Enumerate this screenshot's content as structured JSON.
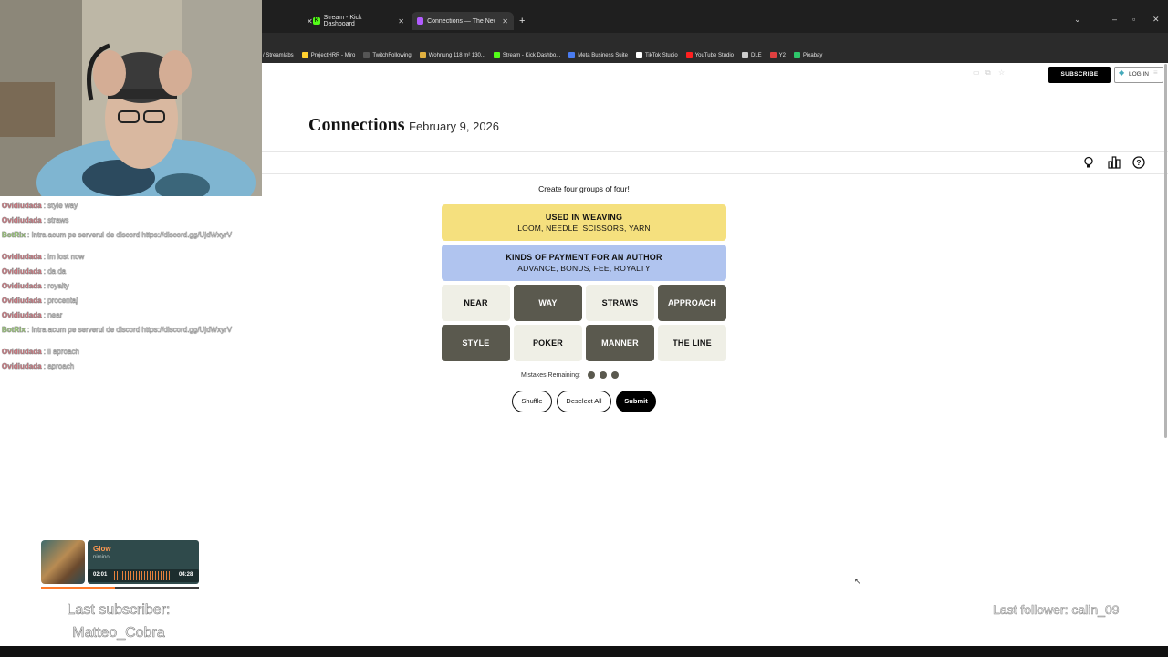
{
  "browser": {
    "tabs": [
      {
        "label": "Stream - Kick Dashboard",
        "icon": "kick-icon",
        "active": false
      },
      {
        "label": "Connections — The New York T",
        "icon": "nyt-games-icon",
        "active": true
      }
    ],
    "new_tab": "+",
    "bookmarks": [
      {
        "label": "/ Streamlabs",
        "color": "#2b2b2b"
      },
      {
        "label": "ProjectHRR - Miro",
        "color": "#ffd02f"
      },
      {
        "label": "TwitchFollowing",
        "color": "#555555"
      },
      {
        "label": "Wohnung 118 m² 130...",
        "color": "#e0b040"
      },
      {
        "label": "Stream - Kick Dashbo...",
        "color": "#53fc18"
      },
      {
        "label": "Meta Business Suite",
        "color": "#4a7cf0"
      },
      {
        "label": "TikTok Studio",
        "color": "#ffffff"
      },
      {
        "label": "YouTube Studio",
        "color": "#ff2020"
      },
      {
        "label": "DLE",
        "color": "#cccccc"
      },
      {
        "label": "Y2",
        "color": "#e04040"
      },
      {
        "label": "Pixabay",
        "color": "#2ec66b"
      }
    ]
  },
  "nyt": {
    "subscribe": "SUBSCRIBE",
    "login": "LOG IN",
    "title": "Connections",
    "date": "February 9, 2026",
    "instructions": "Create four groups of four!",
    "solved_groups": [
      {
        "title": "USED IN WEAVING",
        "members": "LOOM, NEEDLE, SCISSORS, YARN",
        "color": "#f5e07e"
      },
      {
        "title": "KINDS OF PAYMENT FOR AN AUTHOR",
        "members": "ADVANCE, BONUS, FEE, ROYALTY",
        "color": "#b0c4ef"
      }
    ],
    "cards": [
      {
        "word": "NEAR",
        "selected": false
      },
      {
        "word": "WAY",
        "selected": true
      },
      {
        "word": "STRAWS",
        "selected": false
      },
      {
        "word": "APPROACH",
        "selected": true
      },
      {
        "word": "STYLE",
        "selected": true
      },
      {
        "word": "POKER",
        "selected": false
      },
      {
        "word": "MANNER",
        "selected": true
      },
      {
        "word": "THE LINE",
        "selected": false
      }
    ],
    "mistakes_label": "Mistakes Remaining:",
    "mistakes_remaining": 3,
    "buttons": {
      "shuffle": "Shuffle",
      "deselect": "Deselect All",
      "submit": "Submit"
    },
    "icons": [
      "hint-bulb-icon",
      "stats-icon",
      "help-icon"
    ]
  },
  "chat": [
    {
      "user": "Ovidiudada",
      "text": ": style way",
      "bot": false
    },
    {
      "user": "Ovidiudada",
      "text": ": straws",
      "bot": false
    },
    {
      "user": "BotRix",
      "text": ": Intra acum pe serverul de discord https://discord.gg/UjdWxyrV",
      "bot": true
    },
    {
      "user": "Ovidiudada",
      "text": ": im lost now",
      "bot": false
    },
    {
      "user": "Ovidiudada",
      "text": ": da da",
      "bot": false
    },
    {
      "user": "Ovidiudada",
      "text": ": royalty",
      "bot": false
    },
    {
      "user": "Ovidiudada",
      "text": ": procentaj",
      "bot": false
    },
    {
      "user": "Ovidiudada",
      "text": ": near",
      "bot": false
    },
    {
      "user": "BotRix",
      "text": ": Intra acum pe serverul de discord https://discord.gg/UjdWxyrV",
      "bot": true
    },
    {
      "user": "Ovidiudada",
      "text": ": li aproach",
      "bot": false
    },
    {
      "user": "Ovidiudada",
      "text": ": aproach",
      "bot": false
    }
  ],
  "player": {
    "song": "Glow",
    "artist": "nimino",
    "elapsed": "02:01",
    "total": "04:28",
    "progress": 0.47
  },
  "overlay": {
    "last_subscriber": "Last subscriber: Matteo_Cobra",
    "last_follower": "Last follower: calin_09"
  }
}
